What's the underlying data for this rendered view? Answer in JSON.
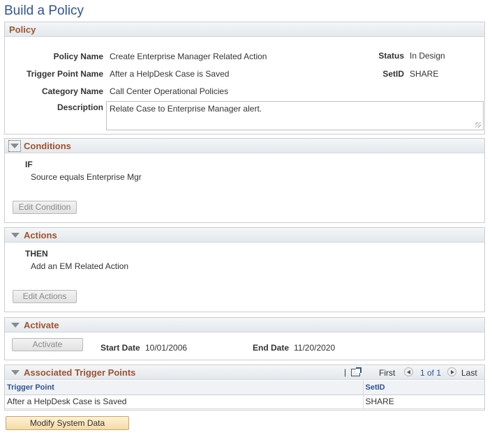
{
  "page": {
    "title": "Build a Policy"
  },
  "policy": {
    "header": "Policy",
    "policy_name_label": "Policy Name",
    "policy_name": "Create Enterprise Manager Related Action",
    "trigger_label": "Trigger Point Name",
    "trigger": "After a HelpDesk Case is Saved",
    "category_label": "Category Name",
    "category": "Call Center Operational Policies",
    "description_label": "Description",
    "description": "Relate Case to Enterprise Manager alert.",
    "status_label": "Status",
    "status": "In Design",
    "setid_label": "SetID",
    "setid": "SHARE"
  },
  "conditions": {
    "header": "Conditions",
    "keyword": "IF",
    "text": "Source equals Enterprise Mgr",
    "button": "Edit Condition"
  },
  "actions": {
    "header": "Actions",
    "keyword": "THEN",
    "text": "Add an EM Related Action",
    "button": "Edit Actions"
  },
  "activate": {
    "header": "Activate",
    "button": "Activate",
    "start_label": "Start Date",
    "start": "10/01/2006",
    "end_label": "End Date",
    "end": "11/20/2020"
  },
  "triggers": {
    "header": "Associated Trigger Points",
    "sep": "|",
    "nav_first": "First",
    "nav_range": "1 of 1",
    "nav_last": "Last",
    "columns": [
      "Trigger Point",
      "SetID"
    ],
    "rows": [
      [
        "After a HelpDesk Case is Saved",
        "SHARE"
      ]
    ]
  },
  "footer": {
    "modify_button": "Modify System Data"
  },
  "colors": {
    "title": "#2f5496",
    "section_title": "#a0522d",
    "link": "#2f5496"
  }
}
